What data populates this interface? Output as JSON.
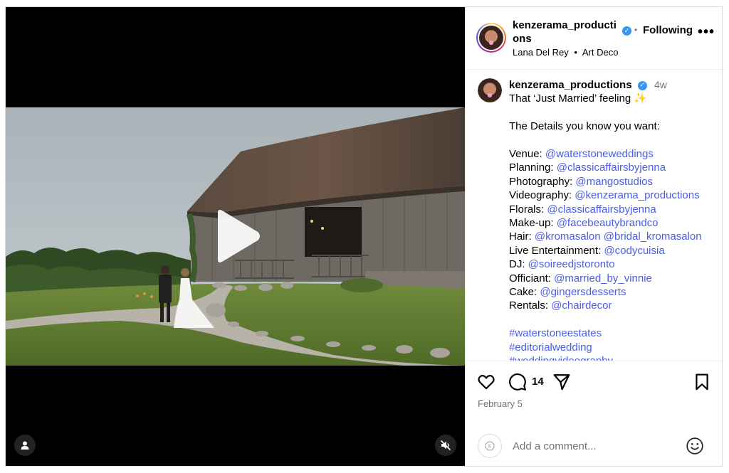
{
  "header": {
    "username": "kenzerama_productions",
    "verified_icon": "verified-badge-icon",
    "separator": "•",
    "follow_state": "Following",
    "more_icon": "more-options-icon",
    "audio": "Lana Del Rey",
    "audio_separator": "•",
    "location": "Art Deco"
  },
  "caption": {
    "username": "kenzerama_productions",
    "time_ago": "4w",
    "headline": "That ‘Just Married’ feeling ✨",
    "intro": "The Details you know you want:",
    "credits": [
      {
        "label": "Venue: ",
        "handles": [
          "@waterstoneweddings"
        ]
      },
      {
        "label": "Planning: ",
        "handles": [
          "@classicaffairsbyjenna"
        ]
      },
      {
        "label": "Photography: ",
        "handles": [
          "@mangostudios"
        ]
      },
      {
        "label": "Videography: ",
        "handles": [
          "@kenzerama_productions"
        ]
      },
      {
        "label": "Florals: ",
        "handles": [
          "@classicaffairsbyjenna"
        ]
      },
      {
        "label": "Make-up: ",
        "handles": [
          "@facebeautybrandco"
        ]
      },
      {
        "label": "Hair: ",
        "handles": [
          "@kromasalon",
          "@bridal_kromasalon"
        ]
      },
      {
        "label": "Live Entertainment: ",
        "handles": [
          "@codycuisia"
        ]
      },
      {
        "label": "DJ: ",
        "handles": [
          "@soireedjstoronto"
        ]
      },
      {
        "label": "Officiant: ",
        "handles": [
          "@married_by_vinnie"
        ]
      },
      {
        "label": "Cake: ",
        "handles": [
          "@gingersdesserts"
        ]
      },
      {
        "label": "Rentals: ",
        "handles": [
          "@chairdecor"
        ]
      }
    ],
    "hashtags": [
      "#waterstoneestates",
      "#editorialwedding",
      "#weddingvideography"
    ]
  },
  "actions": {
    "like_icon": "heart-icon",
    "comment_icon": "comment-icon",
    "comment_count": "14",
    "share_icon": "share-icon",
    "save_icon": "bookmark-icon",
    "date": "February 5"
  },
  "comment_box": {
    "placeholder": "Add a comment...",
    "emoji_icon": "emoji-icon"
  },
  "video": {
    "play_icon": "play-icon",
    "tag_icon": "user-tag-icon",
    "mute_icon": "muted-speaker-icon"
  },
  "colors": {
    "link": "#4b5de6",
    "verified": "#3897f0",
    "muted_text": "#737373",
    "border": "#dbdbdb"
  }
}
